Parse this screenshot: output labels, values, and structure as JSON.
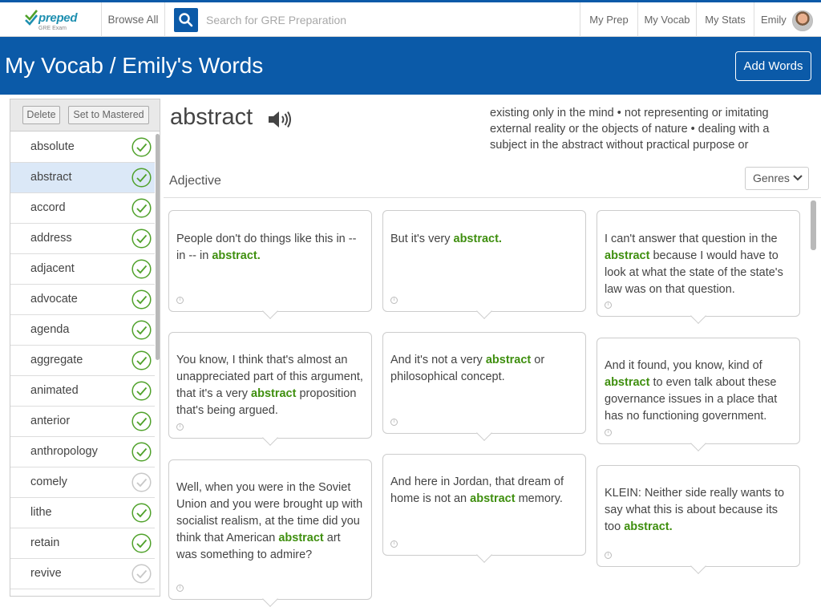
{
  "nav": {
    "logo_brand": "preped",
    "logo_sub": "GRE Exam",
    "browse_all": "Browse All",
    "search_placeholder": "Search for GRE Preparation",
    "links": [
      "My Prep",
      "My Vocab",
      "My Stats",
      "Emily"
    ]
  },
  "header": {
    "title": "My Vocab / Emily's Words",
    "add_words": "Add Words"
  },
  "sidebar": {
    "delete_label": "Delete",
    "mastered_label": "Set to Mastered",
    "words": [
      {
        "word": "absolute",
        "mastered": true
      },
      {
        "word": "abstract",
        "mastered": true,
        "selected": true
      },
      {
        "word": "accord",
        "mastered": true
      },
      {
        "word": "address",
        "mastered": true
      },
      {
        "word": "adjacent",
        "mastered": true
      },
      {
        "word": "advocate",
        "mastered": true
      },
      {
        "word": "agenda",
        "mastered": true
      },
      {
        "word": "aggregate",
        "mastered": true
      },
      {
        "word": "animated",
        "mastered": true
      },
      {
        "word": "anterior",
        "mastered": true
      },
      {
        "word": "anthropology",
        "mastered": true
      },
      {
        "word": "comely",
        "mastered": false
      },
      {
        "word": "lithe",
        "mastered": true
      },
      {
        "word": "retain",
        "mastered": true
      },
      {
        "word": "revive",
        "mastered": false
      }
    ]
  },
  "word": {
    "title": "abstract",
    "definition": "existing only in the mind • not representing or imitating external reality or the objects of nature • dealing with a subject in the abstract without practical purpose or",
    "part_of_speech": "Adjective",
    "genres_label": "Genres"
  },
  "examples": [
    {
      "pre": "People don't do things like this in -- in -- in ",
      "hl": "abstract.",
      "post": ""
    },
    {
      "pre": "But it's very ",
      "hl": "abstract.",
      "post": ""
    },
    {
      "pre": "I can't answer that question in the ",
      "hl": "abstract",
      "post": " because I would have to look at what the state of the state's law was on that question."
    },
    {
      "pre": "You know, I think that's almost an unappreciated part of this argument, that it's a very ",
      "hl": "abstract",
      "post": " proposition that's being argued."
    },
    {
      "pre": "And it's not a very ",
      "hl": "abstract",
      "post": " or philosophical concept."
    },
    {
      "pre": "And it found, you know, kind of ",
      "hl": "abstract",
      "post": " to even talk about these governance issues in a place that has no functioning government."
    },
    {
      "pre": "Well, when you were in the Soviet Union and you were brought up with socialist realism, at the time did you think that American ",
      "hl": "abstract",
      "post": " art was something to admire?"
    },
    {
      "pre": "And here in Jordan, that dream of home is not an ",
      "hl": "abstract",
      "post": " memory."
    },
    {
      "pre": "KLEIN: Neither side really wants to say what this is about because its too ",
      "hl": "abstract.",
      "post": ""
    }
  ],
  "colors": {
    "brand_blue": "#0b5aa8",
    "highlight_green": "#3f8f0f",
    "check_green": "#4fa12a"
  }
}
